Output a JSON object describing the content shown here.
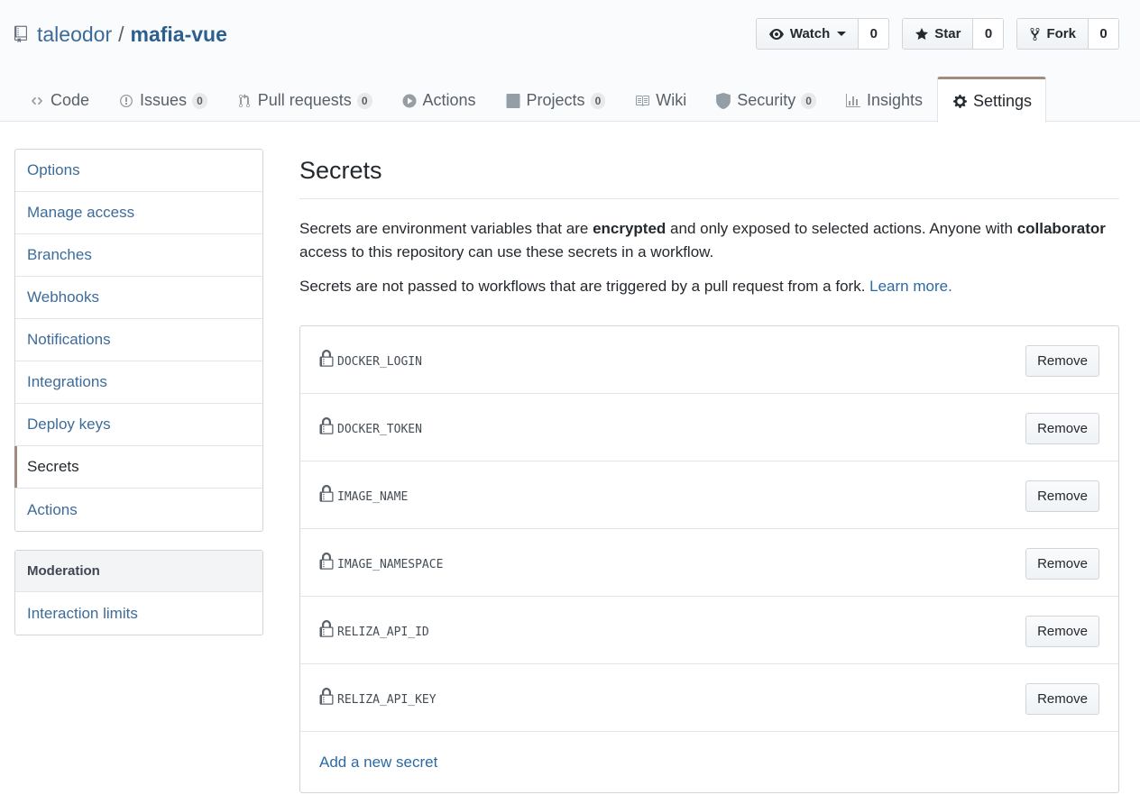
{
  "repo": {
    "owner": "taleodor",
    "separator": "/",
    "name": "mafia-vue"
  },
  "actions": {
    "watch": {
      "label": "Watch",
      "count": "0"
    },
    "star": {
      "label": "Star",
      "count": "0"
    },
    "fork": {
      "label": "Fork",
      "count": "0"
    }
  },
  "tabs": [
    {
      "label": "Code",
      "icon": "code-icon"
    },
    {
      "label": "Issues",
      "icon": "issue-icon",
      "counter": "0"
    },
    {
      "label": "Pull requests",
      "icon": "pull-request-icon",
      "counter": "0"
    },
    {
      "label": "Actions",
      "icon": "play-icon"
    },
    {
      "label": "Projects",
      "icon": "project-icon",
      "counter": "0"
    },
    {
      "label": "Wiki",
      "icon": "book-icon"
    },
    {
      "label": "Security",
      "icon": "shield-icon",
      "counter": "0"
    },
    {
      "label": "Insights",
      "icon": "graph-icon"
    },
    {
      "label": "Settings",
      "icon": "gear-icon",
      "selected": true
    }
  ],
  "sidebar": {
    "items": [
      {
        "label": "Options"
      },
      {
        "label": "Manage access"
      },
      {
        "label": "Branches"
      },
      {
        "label": "Webhooks"
      },
      {
        "label": "Notifications"
      },
      {
        "label": "Integrations"
      },
      {
        "label": "Deploy keys"
      },
      {
        "label": "Secrets",
        "selected": true
      },
      {
        "label": "Actions"
      }
    ],
    "moderation": {
      "heading": "Moderation",
      "items": [
        {
          "label": "Interaction limits"
        }
      ]
    }
  },
  "main": {
    "title": "Secrets",
    "desc1": {
      "part1": "Secrets are environment variables that are ",
      "bold1": "encrypted",
      "part2": " and only exposed to selected actions. Anyone with ",
      "bold2": "collaborator",
      "part3": " access to this repository can use these secrets in a workflow."
    },
    "desc2": {
      "text": "Secrets are not passed to workflows that are triggered by a pull request from a fork. ",
      "link": "Learn more."
    },
    "secrets": [
      {
        "name": "DOCKER_LOGIN",
        "button": "Remove"
      },
      {
        "name": "DOCKER_TOKEN",
        "button": "Remove"
      },
      {
        "name": "IMAGE_NAME",
        "button": "Remove"
      },
      {
        "name": "IMAGE_NAMESPACE",
        "button": "Remove"
      },
      {
        "name": "RELIZA_API_ID",
        "button": "Remove"
      },
      {
        "name": "RELIZA_API_KEY",
        "button": "Remove"
      }
    ],
    "add_link": "Add a new secret"
  },
  "colors": {
    "link": "#0366d6",
    "selected_accent": "#a28c7f",
    "border": "#d1d5da"
  }
}
